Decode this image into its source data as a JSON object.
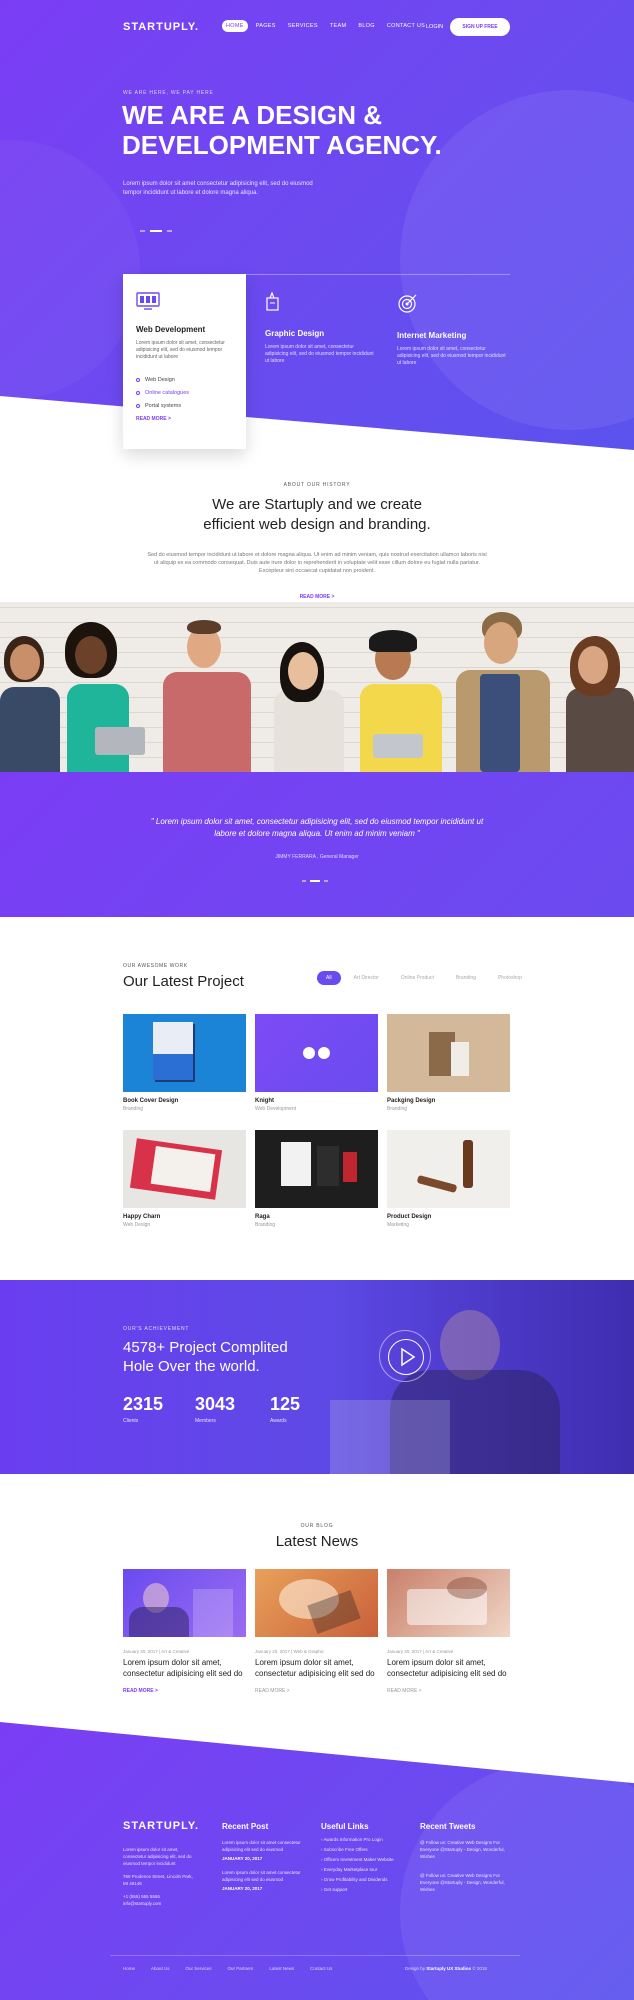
{
  "colors": {
    "accent": "#7b3df4",
    "accent_2": "#6a4bf0",
    "white": "#ffffff"
  },
  "nav": {
    "logo": "STARTUPLY.",
    "links": [
      "HOME",
      "PAGES",
      "SERVICES",
      "TEAM",
      "BLOG",
      "CONTACT US"
    ],
    "login": "LOGIN",
    "signup": "SIGN UP FREE"
  },
  "hero": {
    "kicker": "WE ARE HERE, WE PAY HERE",
    "title": "WE ARE A DESIGN & DEVELOPMENT AGENCY.",
    "description": "Lorem ipsum dolor sit amet consectetur adipisicing elit, sed do eiusmod tempor incididunt ut labore et dolore magna aliqua."
  },
  "services": [
    {
      "icon": "monitor-icon",
      "title": "Web Development",
      "desc": "Lorem ipsum dolor sit amet, consectetur adipisicing elit, sed do eiusmod tempor incididunt ut labore",
      "list": [
        "Web Design",
        "Online catalogues",
        "Portal systems"
      ],
      "more": "READ MORE >"
    },
    {
      "icon": "pen-tool-icon",
      "title": "Graphic Design",
      "desc": "Lorem ipsum dolor sit amet, consectetur adipisicing elit, sed do eiusmod tempor incididunt ut labore"
    },
    {
      "icon": "target-icon",
      "title": "Internet Marketing",
      "desc": "Lorem ipsum dolor sit amet, consectetur adipisicing elit, sed do eiusmod tempor incididunt ut labore"
    }
  ],
  "about": {
    "kicker": "ABOUT OUR HISTORY",
    "title_line1": "We are Startuply and we create",
    "title_line2": "efficient web design and branding.",
    "desc": "Sed do eiusmod tempor incididunt ut labore et dolore magna aliqua. Ut enim ad minim veniam, quis nostrud exercitation ullamco laboris nisi ut aliquip ex ea commodo consequat. Duis aute irure dolor in reprehenderit in voluptate velit esse cillum dolore eu fugiat nulla pariatur. Excepteur sint occaecat cupidatat non proident.",
    "more": "READ MORE >"
  },
  "testimonial": {
    "quote": "\" Lorem ipsum dolor sit amet, consectetur adipisicing elit, sed do eiusmod tempor incididunt ut labore et dolore magna aliqua. Ut enim ad minim veniam \"",
    "author": "JIMMY FERRARA , General Manager"
  },
  "projects": {
    "kicker": "OUR AWESOME WORK",
    "title": "Our Latest Project",
    "filters": [
      "All",
      "Art Director",
      "Online Product",
      "Branding",
      "Photoshop"
    ],
    "items": [
      {
        "name": "Book Cover Design",
        "cat": "Branding"
      },
      {
        "name": "Knight",
        "cat": "Web Development"
      },
      {
        "name": "Packging Design",
        "cat": "Branding"
      },
      {
        "name": "Happy Charn",
        "cat": "Web Design"
      },
      {
        "name": "Raga",
        "cat": "Branding"
      },
      {
        "name": "Product Design",
        "cat": "Marketing"
      }
    ]
  },
  "achievement": {
    "kicker": "OUR'S ACHIEVEMENT",
    "title_line1": "4578+ Project Complited",
    "title_line2": "Hole Over the world.",
    "stats": [
      {
        "value": "2315",
        "label": "Clients"
      },
      {
        "value": "3043",
        "label": "Members"
      },
      {
        "value": "125",
        "label": "Awards"
      }
    ]
  },
  "news": {
    "kicker": "OUR BLOG",
    "title": "Latest News",
    "items": [
      {
        "meta": "January 20, 2017   |   Art & Creative",
        "title": "Lorem ipsum dolor sit amet, consectetur adipisicing elit sed do",
        "more": "READ MORE >"
      },
      {
        "meta": "January 20, 2017   |   Web & Graphic",
        "title": "Lorem ipsum dolor sit amet, consectetur adipisicing elit sed do",
        "more": "READ MORE >"
      },
      {
        "meta": "January 20, 2017   |   Art & Creative",
        "title": "Lorem ipsum dolor sit amet, consectetur adipisicing elit sed do",
        "more": "READ MORE >"
      }
    ]
  },
  "footer": {
    "logo": "STARTUPLY.",
    "about": "Lorem ipsum dolor sit amet, consectetur adipisicing elit, sed do eiusmod tempor incididunt",
    "address": "769 Prudence Street, Lincoln Park, MI 48146",
    "phone": "+1 (555) 555 5555",
    "email": "info@startuply.com",
    "recent_post_title": "Recent Post",
    "posts": [
      {
        "text": "Lorem ipsum dolor sit amet consectetur adipisicing elit sed do eiusmod",
        "date": "JANUARY 20, 2017"
      },
      {
        "text": "Lorem ipsum dolor sit amet consectetur adipisicing elit sed do eiusmod",
        "date": "JANUARY 20, 2017"
      }
    ],
    "links_title": "Useful Links",
    "links": [
      "Awards Information Pro Login",
      "Subscribe Free Offers",
      "Officers Investment Maker Website",
      "Everyday Marketplace tour",
      "Grow Profitability and Dividends",
      "Get support"
    ],
    "tweets_title": "Recent Tweets",
    "tweets": [
      "@ Follow us: Creative Web Designs For Everyone @Startuply - Design, Wonderful, Wishes",
      "@ Follow us: Creative Web Designs For Everyone @Startuply - Design, Wonderful, Wishes"
    ],
    "bottom_links": [
      "Home",
      "About Us",
      "Our Services",
      "Our Partners",
      "Latest News",
      "Contact Us"
    ],
    "copyright_prefix": "Design by",
    "copyright_brand": "Startuply UX Studios",
    "copyright_year": "© 2018"
  }
}
